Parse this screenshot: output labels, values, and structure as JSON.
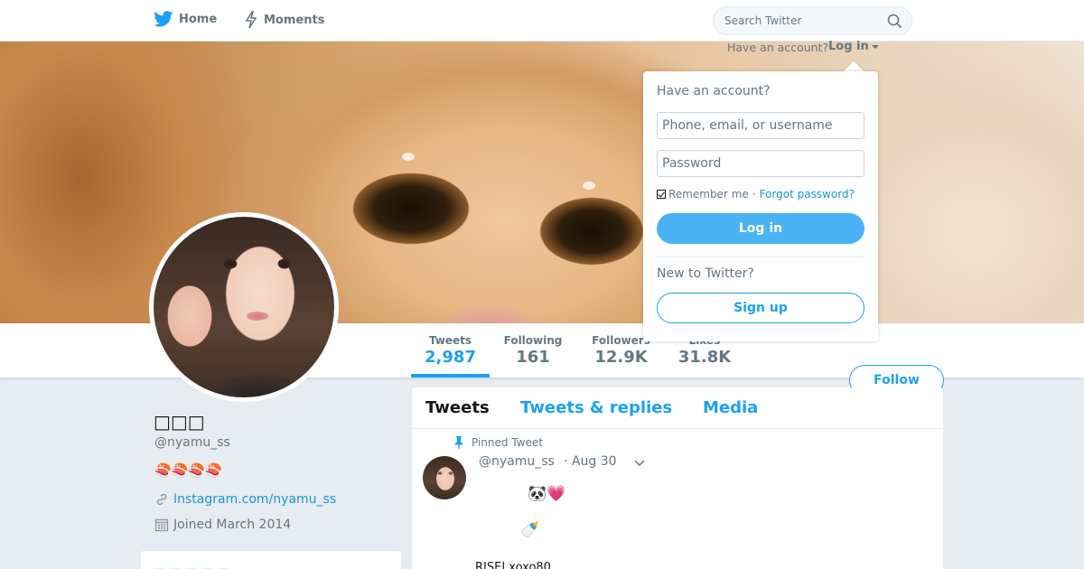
{
  "nav": {
    "home_label": "Home",
    "moments_label": "Moments",
    "search_placeholder": "Search Twitter"
  },
  "login_prompt": {
    "have_account_text": "Have an account?",
    "login_link": "Log in"
  },
  "dropdown": {
    "heading": "Have an account?",
    "username_placeholder": "Phone, email, or username",
    "password_placeholder": "Password",
    "remember_label": "Remember me",
    "separator": "·",
    "forgot_label": "Forgot password?",
    "login_button": "Log in",
    "new_heading": "New to Twitter?",
    "signup_button": "Sign up"
  },
  "stats": [
    {
      "label": "Tweets",
      "value": "2,987"
    },
    {
      "label": "Following",
      "value": "161"
    },
    {
      "label": "Followers",
      "value": "12.9K"
    },
    {
      "label": "Likes",
      "value": "31.8K"
    }
  ],
  "follow_label": "Follow",
  "profile": {
    "name": "□□□",
    "handle": "@nyamu_ss",
    "bio": "🍣🍣🍣🍣",
    "link": "Instagram.com/nyamu_ss",
    "joined": "Joined March 2014",
    "card_text": "— — — — —"
  },
  "timeline": {
    "tabs": [
      "Tweets",
      "Tweets & replies",
      "Media"
    ],
    "pinned_label": "Pinned Tweet",
    "tweet": {
      "handle": "@nyamu_ss",
      "date": "· Aug 30",
      "emoji_line1": "🐼💗",
      "emoji_line2": "🍼",
      "text": "RISEI xoxo80"
    }
  },
  "colors": {
    "accent": "#1da1f2",
    "link": "#1b95e0",
    "muted": "#657786"
  }
}
